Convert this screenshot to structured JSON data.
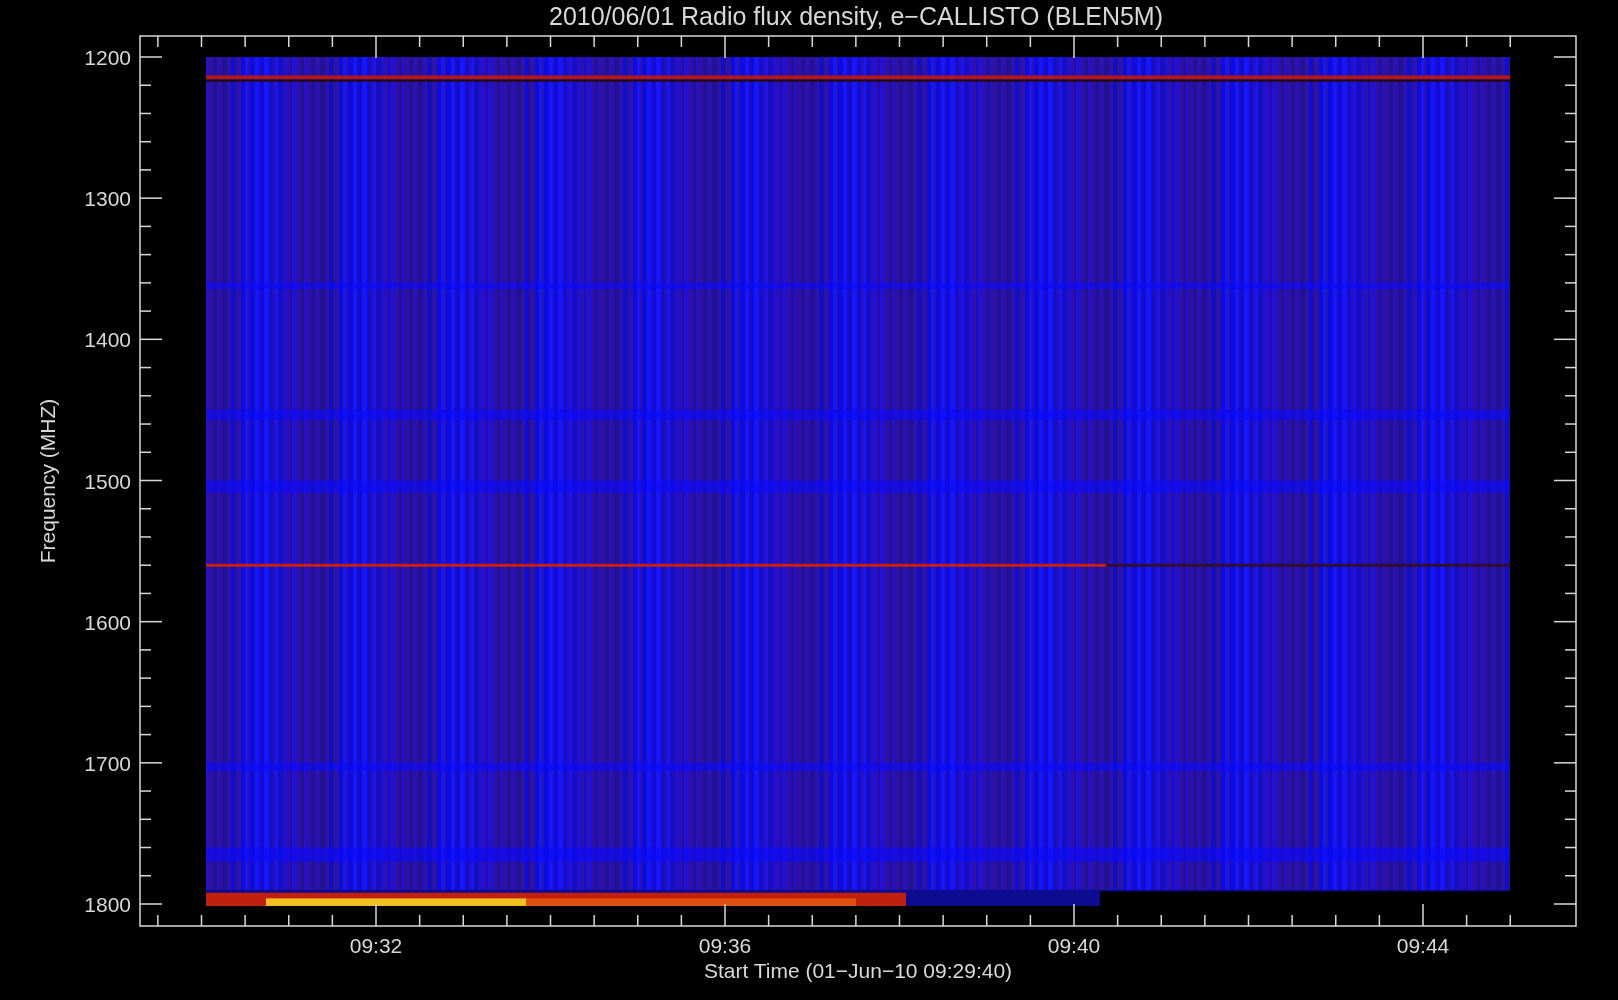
{
  "title": "2010/06/01  Radio flux density, e−CALLISTO (BLEN5M)",
  "y_axis": {
    "label": "Frequency (MHZ)",
    "ticks": [
      "1200",
      "1300",
      "1400",
      "1500",
      "1600",
      "1700",
      "1800"
    ]
  },
  "x_axis": {
    "label": "Start Time (01−Jun−10 09:29:40)",
    "ticks": [
      "09:32",
      "09:36",
      "09:40",
      "09:44"
    ]
  }
}
